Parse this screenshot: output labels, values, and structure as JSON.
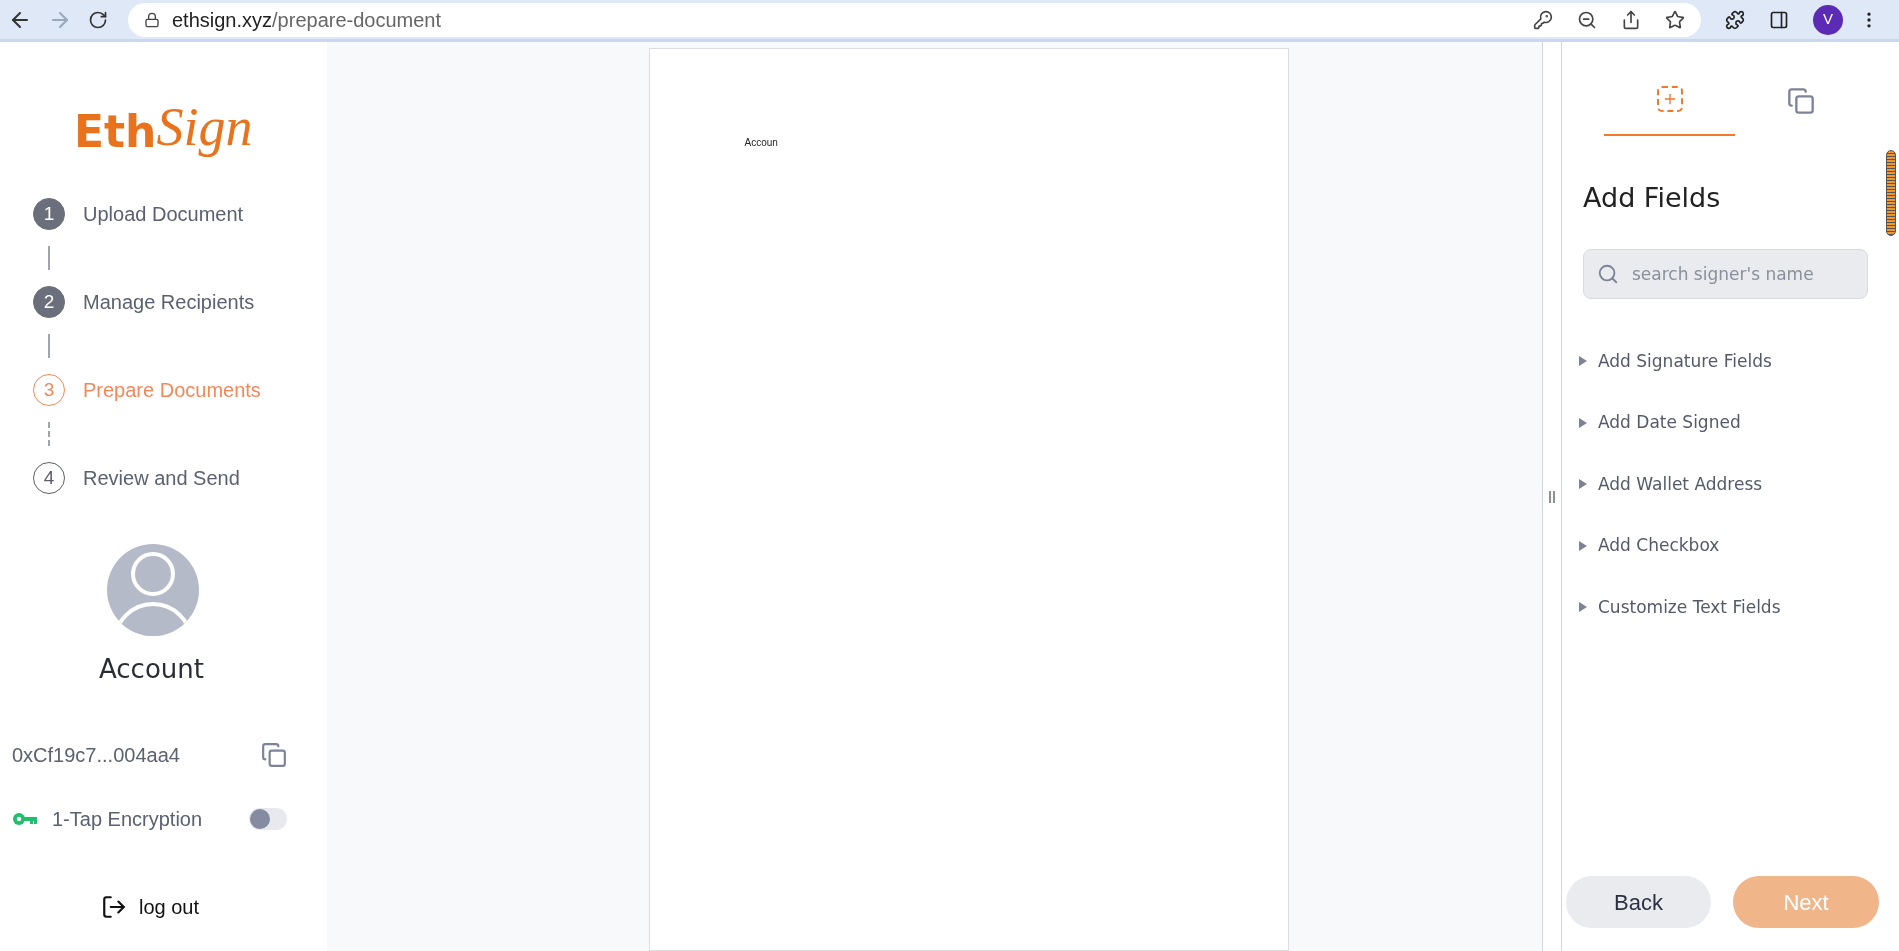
{
  "browser": {
    "url_host": "ethsign.xyz",
    "url_path": "/prepare-document",
    "profile": "V"
  },
  "logo": {
    "part_1": "Eth",
    "part_2": "Sign"
  },
  "steps": [
    {
      "number": "1",
      "label": "Upload Document",
      "completed": true,
      "selected": false
    },
    {
      "number": "2",
      "label": "Manage Recipients",
      "completed": true,
      "selected": false
    },
    {
      "number": "3",
      "label": "Prepare Documents",
      "completed": false,
      "selected": true
    },
    {
      "number": "4",
      "label": "Review and Send",
      "completed": false,
      "selected": false
    }
  ],
  "account": {
    "title": "Account",
    "address": "0xCf19c7...004aa4",
    "encryption_label": "1-Tap Encryption",
    "encryption_on": false,
    "logout": "log out"
  },
  "document": {
    "text": "Accoun"
  },
  "panel": {
    "tabs": [
      {
        "kind": "add",
        "selected": true
      },
      {
        "kind": "pages",
        "selected": false
      }
    ],
    "title": "Add Fields",
    "search": {
      "placeholder": "search signer's name"
    },
    "items": [
      {
        "label": "Add Signature Fields",
        "expanded": false
      },
      {
        "label": "Add Date Signed",
        "expanded": false
      },
      {
        "label": "Add Wallet Address",
        "expanded": false
      },
      {
        "label": "Add Checkbox",
        "expanded": false
      },
      {
        "label": "Customize Text Fields",
        "expanded": false
      }
    ]
  },
  "buttons": {
    "back": {
      "label": "Back"
    },
    "next": {
      "label": "Next",
      "disabled": true
    }
  }
}
